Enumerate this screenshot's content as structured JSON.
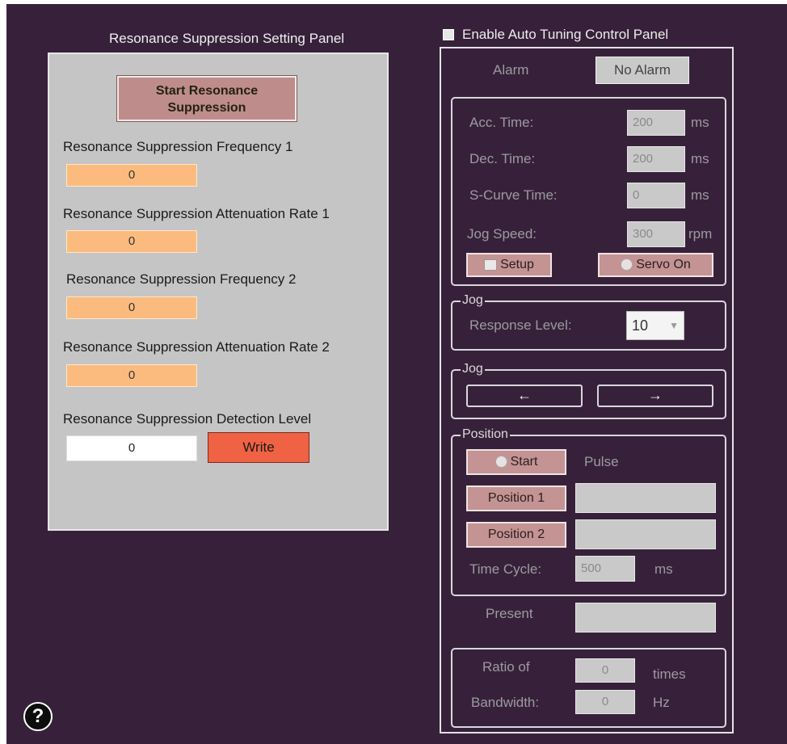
{
  "left_panel": {
    "title": "Resonance Suppression Setting Panel",
    "start_button": "Start Resonance Suppression",
    "freq1_label": "Resonance Suppression Frequency 1",
    "freq1_value": "0",
    "atten1_label": "Resonance Suppression Attenuation Rate 1",
    "atten1_value": "0",
    "freq2_label": "Resonance Suppression Frequency 2",
    "freq2_value": "0",
    "atten2_label": "Resonance Suppression Attenuation Rate 2",
    "atten2_value": "0",
    "detect_label": "Resonance Suppression Detection Level",
    "detect_value": "0",
    "write_button": "Write"
  },
  "help": {
    "label": "?"
  },
  "right_panel": {
    "enable_label": "Enable Auto Tuning Control Panel",
    "enable_checked": false,
    "alarm_label": "Alarm",
    "alarm_value": "No Alarm",
    "params": {
      "acc_label": "Acc. Time:",
      "acc_value": "200",
      "acc_unit": "ms",
      "dec_label": "Dec. Time:",
      "dec_value": "200",
      "dec_unit": "ms",
      "scurve_label": "S-Curve Time:",
      "scurve_value": "0",
      "scurve_unit": "ms",
      "jog_speed_label": "Jog Speed:",
      "jog_speed_value": "300",
      "jog_speed_unit": "rpm",
      "setup_button": "Setup",
      "servo_button": "Servo On"
    },
    "jog1": {
      "title": "Jog",
      "response_label": "Response Level:",
      "response_value": "10"
    },
    "jog2": {
      "title": "Jog",
      "left_arrow": "←",
      "right_arrow": "→"
    },
    "position": {
      "title": "Position",
      "start_button": "Start",
      "pulse_label": "Pulse",
      "pos1_button": "Position 1",
      "pos1_value": "",
      "pos2_button": "Position 2",
      "pos2_value": "",
      "cycle_label": "Time Cycle:",
      "cycle_value": "500",
      "cycle_unit": "ms"
    },
    "present_label": "Present",
    "present_value": "",
    "bandwidth": {
      "ratio_label": "Ratio of",
      "ratio_value": "0",
      "ratio_unit": "times",
      "bw_label": "Bandwidth:",
      "bw_value": "0",
      "bw_unit": "Hz"
    }
  },
  "colors": {
    "background": "#37213a",
    "panel": "#c5c5c5",
    "field_orange": "#fcbb7e",
    "write_red": "#f06244",
    "button_pink": "#c49393"
  }
}
